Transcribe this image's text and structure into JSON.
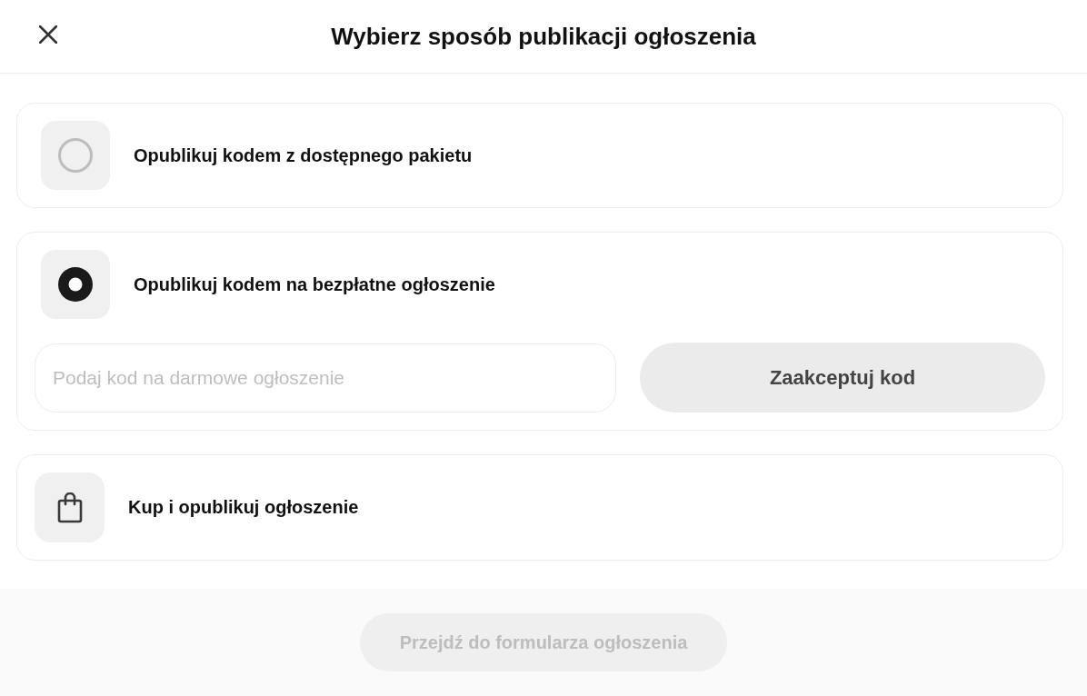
{
  "header": {
    "title": "Wybierz sposób publikacji ogłoszenia"
  },
  "options": [
    {
      "kind": "radio",
      "label": "Opublikuj kodem z dostępnego pakietu",
      "selected": false
    },
    {
      "kind": "radio",
      "label": "Opublikuj kodem na bezpłatne ogłoszenie",
      "selected": true,
      "code_field": {
        "placeholder": "Podaj kod na darmowe ogłoszenie"
      },
      "accept_button": {
        "label": "Zaakceptuj kod"
      }
    },
    {
      "kind": "purchase",
      "label": "Kup i opublikuj ogłoszenie"
    }
  ],
  "footer": {
    "button": {
      "label": "Przejdź do formularza ogłoszenia",
      "disabled": true
    }
  }
}
